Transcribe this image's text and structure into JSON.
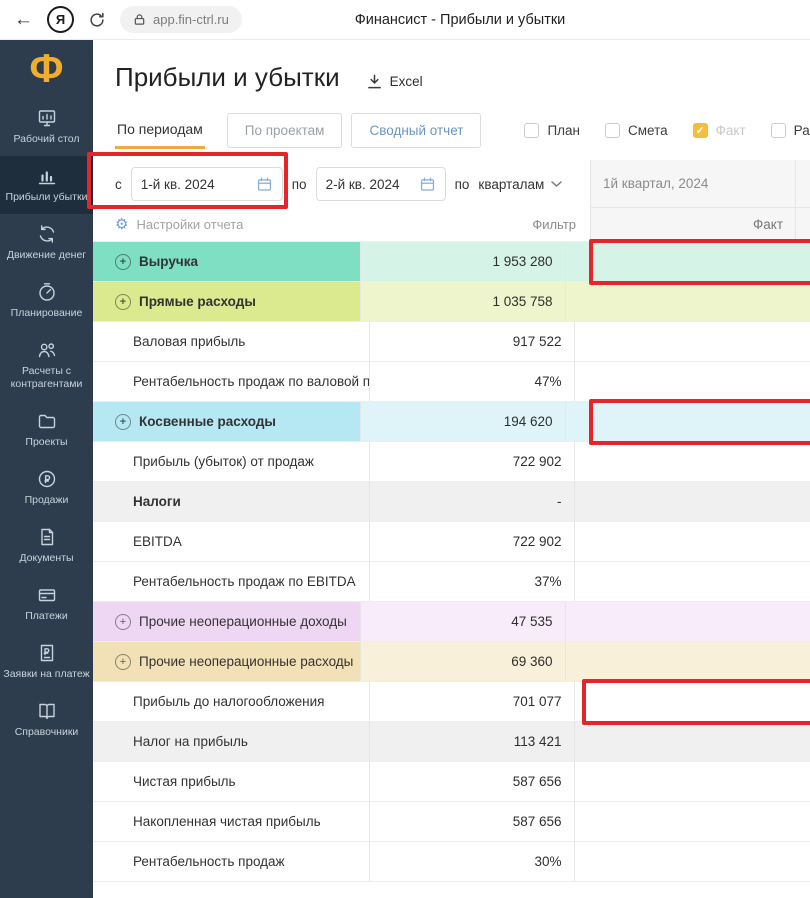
{
  "browser": {
    "url": "app.fin-ctrl.ru",
    "page_title": "Финансист - Прибыли и убытки",
    "browser_logo": "Я"
  },
  "sidebar": {
    "logo": "Ф",
    "items": [
      {
        "label": "Рабочий стол",
        "icon": "desktop-icon",
        "active": false
      },
      {
        "label": "Прибыли убытки",
        "icon": "chart-icon",
        "active": true
      },
      {
        "label": "Движение денег",
        "icon": "money-flow-icon",
        "active": false
      },
      {
        "label": "Планирование",
        "icon": "planning-icon",
        "active": false
      },
      {
        "label": "Расчеты с контрагентами",
        "icon": "contractors-icon",
        "active": false
      },
      {
        "label": "Проекты",
        "icon": "projects-icon",
        "active": false
      },
      {
        "label": "Продажи",
        "icon": "sales-icon",
        "active": false
      },
      {
        "label": "Документы",
        "icon": "documents-icon",
        "active": false
      },
      {
        "label": "Платежи",
        "icon": "payments-icon",
        "active": false
      },
      {
        "label": "Заявки на платеж",
        "icon": "payment-request-icon",
        "active": false
      },
      {
        "label": "Справочники",
        "icon": "directories-icon",
        "active": false
      }
    ]
  },
  "header": {
    "title": "Прибыли и убытки",
    "export_label": "Excel"
  },
  "tabs": [
    {
      "label": "По периодам",
      "active": true
    },
    {
      "label": "По проектам",
      "active": false
    },
    {
      "label": "Сводный отчет",
      "active": false
    }
  ],
  "checkboxes": [
    {
      "label": "План",
      "checked": false
    },
    {
      "label": "Смета",
      "checked": false
    },
    {
      "label": "Факт",
      "checked": true
    },
    {
      "label": "Распред",
      "checked": false
    }
  ],
  "filters": {
    "from_label": "с",
    "from_value": "1-й кв. 2024",
    "to_label": "по",
    "to_value": "2-й кв. 2024",
    "group_label": "по",
    "group_value": "кварталам",
    "settings_label": "Настройки отчета",
    "filter_label": "Фильтр"
  },
  "table": {
    "period_header": "1й квартал, 2024",
    "fact_header": "Факт",
    "rows": [
      {
        "label": "Выручка",
        "value": "1 953 280",
        "type": "revenue",
        "expandable": true
      },
      {
        "label": "Прямые расходы",
        "value": "1 035 758",
        "type": "direct",
        "expandable": true
      },
      {
        "label": "Валовая прибыль",
        "value": "917 522",
        "type": "plain",
        "expandable": false
      },
      {
        "label": "Рентабельность продаж по валовой прибыли",
        "value": "47%",
        "type": "plain",
        "expandable": false
      },
      {
        "label": "Косвенные расходы",
        "value": "194 620",
        "type": "indirect",
        "expandable": true
      },
      {
        "label": "Прибыль (убыток) от продаж",
        "value": "722 902",
        "type": "plain",
        "expandable": false
      },
      {
        "label": "Налоги",
        "value": "-",
        "type": "gray",
        "expandable": false
      },
      {
        "label": "EBITDA",
        "value": "722 902",
        "type": "plain",
        "expandable": false
      },
      {
        "label": "Рентабельность продаж по EBITDA",
        "value": "37%",
        "type": "plain",
        "expandable": false
      },
      {
        "label": "Прочие неоперационные доходы",
        "value": "47 535",
        "type": "other-income",
        "expandable": true
      },
      {
        "label": "Прочие неоперационные расходы",
        "value": "69 360",
        "type": "other-expense",
        "expandable": true
      },
      {
        "label": "Прибыль до налогообложения",
        "value": "701 077",
        "type": "plain",
        "expandable": false
      },
      {
        "label": "Налог на прибыль",
        "value": "113 421",
        "type": "gray",
        "expandable": false
      },
      {
        "label": "Чистая прибыль",
        "value": "587 656",
        "type": "plain",
        "expandable": false
      },
      {
        "label": "Накопленная чистая прибыль",
        "value": "587 656",
        "type": "plain",
        "expandable": false
      },
      {
        "label": "Рентабельность продаж",
        "value": "30%",
        "type": "plain",
        "expandable": false
      }
    ]
  },
  "annotations": {
    "color": "#e5252a",
    "highlighted": [
      "from-period-picker: с 1-й кв. 2024",
      "Выручка / Факт: 1 953 280",
      "Косвенные расходы / Факт: 194 620",
      "Прибыль до налогообложения / Факт: 701 077"
    ]
  },
  "colors": {
    "accent_amber": "#f2a93b",
    "annotation_red": "#e5252a",
    "sidebar_bg": "#2e3d4e",
    "revenue_row": "#7fdfc2",
    "direct_costs_row": "#dbe98f",
    "indirect_costs_row": "#b6e8f3",
    "other_income_row": "#eed7f2",
    "other_expense_row": "#f2e1b6"
  }
}
